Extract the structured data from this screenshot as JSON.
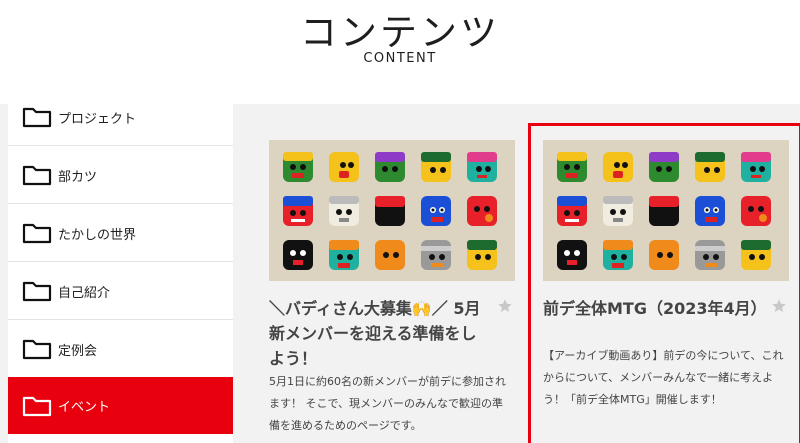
{
  "header": {
    "title": "コンテンツ",
    "subtitle": "CONTENT"
  },
  "sidebar": {
    "items": [
      {
        "label": "プロジェクト"
      },
      {
        "label": "部カツ"
      },
      {
        "label": "たかしの世界"
      },
      {
        "label": "自己紹介"
      },
      {
        "label": "定例会"
      },
      {
        "label": "イベント",
        "active": true
      }
    ]
  },
  "cards": [
    {
      "title": "＼バディさん大募集🙌／ 5月新メンバーを迎える準備をしよう！",
      "description": "5月1日に約60名の新メンバーが前デに参加されます！ そこで、現メンバーのみんなで歓迎の準備を進めるためのページです。"
    },
    {
      "title": "前デ全体MTG（2023年4月）",
      "description": "【アーカイブ動画あり】前デの今について、これからについて、メンバーみんなで一緒に考えよう！「前デ全体MTG」開催します！",
      "highlighted": true
    }
  ],
  "colors": {
    "accent": "#e8000e",
    "thumbnail_bg": "#ddd3c1"
  }
}
